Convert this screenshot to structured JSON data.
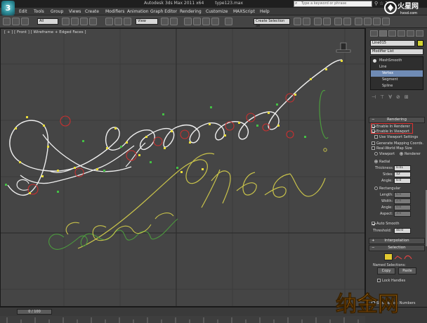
{
  "window": {
    "app_logo": "3",
    "title_parts": [
      "Autodesk 3ds Max  2011 x64",
      "type123.max"
    ],
    "search_placeholder": "Type a keyword or phrase"
  },
  "menu": {
    "items": [
      "Edit",
      "Tools",
      "Group",
      "Views",
      "Create",
      "Modifiers",
      "Animation",
      "Graph Editor",
      "Rendering",
      "Customize",
      "MAXScript",
      "Help"
    ]
  },
  "toolbar": {
    "selection_filter": "All",
    "ref_coord": "View",
    "named_sel": "Create Selection Se"
  },
  "viewport": {
    "label": "[ + ] [ Front ] [ Wireframe + Edged Faces ]",
    "colors": {
      "bg": "#454545",
      "grid": "#3a3a3a",
      "spline_main": "#efefef",
      "spline_yellow": "#c8c24a",
      "spline_green": "#4c9a3e",
      "vertex_yellow": "#e8dc3a",
      "vertex_green": "#44c044",
      "marker_red": "#c83030"
    }
  },
  "command_panel": {
    "object_name": "Line015",
    "object_color": "#d4d431",
    "modifier_list_label": "Modifier List",
    "stack": [
      {
        "label": "MeshSmooth",
        "selected": false,
        "sub": false
      },
      {
        "label": "Line",
        "selected": false,
        "sub": false
      },
      {
        "label": "Vertex",
        "selected": true,
        "sub": true
      },
      {
        "label": "Segment",
        "selected": false,
        "sub": true
      },
      {
        "label": "Spline",
        "selected": false,
        "sub": true
      }
    ],
    "rendering": {
      "title": "Rendering",
      "enable_in_renderer": "Enable In Renderer",
      "enable_in_viewport": "Enable In Viewport",
      "use_viewport_settings": "Use Viewport Settings",
      "generate_mapping": "Generate Mapping Coords.",
      "real_world_map": "Real-World Map Size",
      "viewport_radio": "Viewport",
      "renderer_radio": "Renderer",
      "radial_label": "Radial",
      "thickness_label": "Thickness:",
      "thickness_value": "0.01",
      "sides_label": "Sides:",
      "sides_value": "12",
      "angle_label": "Angle:",
      "angle_value": "0.0",
      "rectangular_label": "Rectangular",
      "length_label": "Length:",
      "length_value": "6.0",
      "width_label": "Width:",
      "width_value": "2.0",
      "rect_angle_label": "Angle:",
      "rect_angle_value": "0.0",
      "aspect_label": "Aspect:",
      "aspect_value": "3.0",
      "auto_smooth": "Auto Smooth",
      "threshold_label": "Threshold:",
      "threshold_value": "40.0"
    },
    "interpolation_title": "Interpolation",
    "selection_title": "Selection",
    "named_selections_label": "Named Selections:",
    "copy_label": "Copy",
    "paste_label": "Paste",
    "lock_handles": "Lock Handles",
    "show_vertex_numbers": "Show Vertex Numbers"
  },
  "timeline": {
    "frame_display": "0 / 100"
  },
  "watermarks": {
    "top_text": "火星网",
    "top_sub": "hxsd.com",
    "bottom_text": "纳金网"
  }
}
